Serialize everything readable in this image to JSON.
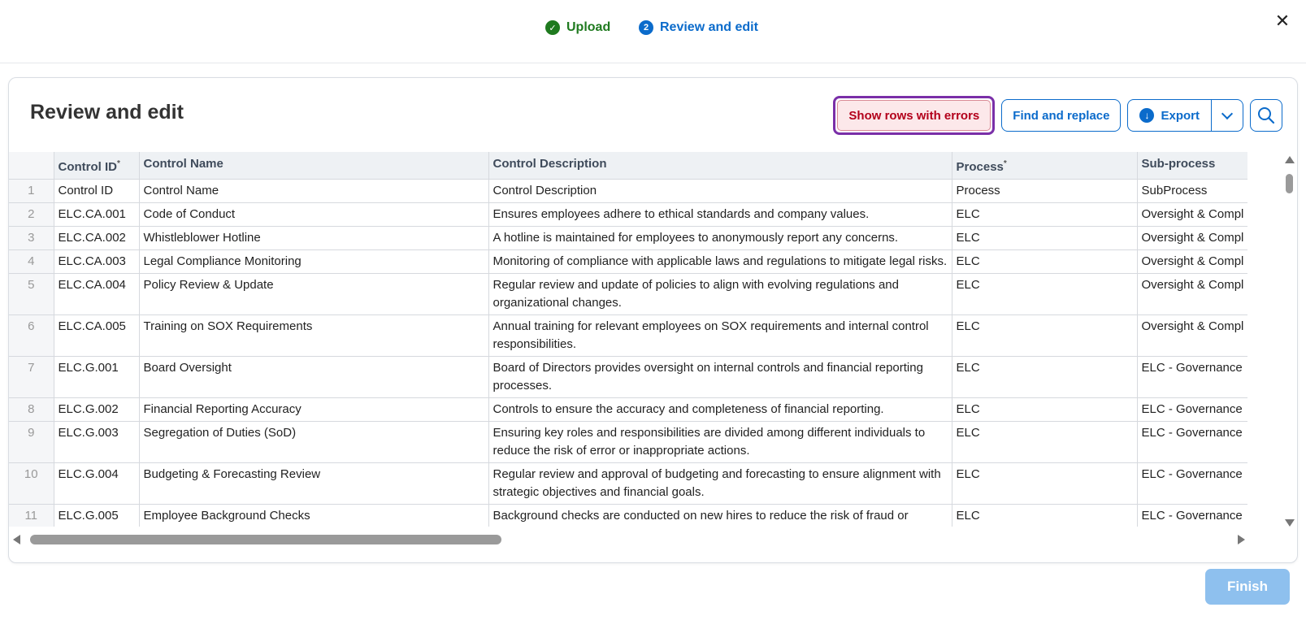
{
  "stepper": {
    "steps": [
      {
        "label": "Upload",
        "badge": "✓"
      },
      {
        "label": "Review and edit",
        "badge": "2"
      }
    ],
    "close_label": "✕"
  },
  "card": {
    "title": "Review and edit",
    "toolbar": {
      "show_errors": "Show rows with errors",
      "find_replace": "Find and replace",
      "export": "Export"
    }
  },
  "table": {
    "columns": [
      "Control ID",
      "Control Name",
      "Control Description",
      "Process",
      "Sub-process"
    ],
    "required": [
      "*",
      "",
      "",
      "*",
      ""
    ],
    "rows": [
      {
        "n": "1",
        "id": "Control ID",
        "name": "Control Name",
        "desc": "Control Description",
        "process": "Process",
        "sub": "SubProcess"
      },
      {
        "n": "2",
        "id": "ELC.CA.001",
        "name": "Code of Conduct",
        "desc": "Ensures employees adhere to ethical standards and company values.",
        "process": "ELC",
        "sub": "Oversight & Compl"
      },
      {
        "n": "3",
        "id": "ELC.CA.002",
        "name": "Whistleblower Hotline",
        "desc": "A hotline is maintained for employees to anonymously report any concerns.",
        "process": "ELC",
        "sub": "Oversight & Compl"
      },
      {
        "n": "4",
        "id": "ELC.CA.003",
        "name": "Legal Compliance Monitoring",
        "desc": "Monitoring of compliance with applicable laws and regulations to mitigate legal risks.",
        "process": "ELC",
        "sub": "Oversight & Compl"
      },
      {
        "n": "5",
        "id": "ELC.CA.004",
        "name": "Policy Review & Update",
        "desc": "Regular review and update of policies to align with evolving regulations and organizational changes.",
        "process": "ELC",
        "sub": "Oversight & Compl"
      },
      {
        "n": "6",
        "id": "ELC.CA.005",
        "name": "Training on SOX Requirements",
        "desc": "Annual training for relevant employees on SOX requirements and internal control responsibilities.",
        "process": "ELC",
        "sub": "Oversight & Compl"
      },
      {
        "n": "7",
        "id": "ELC.G.001",
        "name": "Board Oversight",
        "desc": "Board of Directors provides oversight on internal controls and financial reporting processes.",
        "process": "ELC",
        "sub": "ELC - Governance"
      },
      {
        "n": "8",
        "id": "ELC.G.002",
        "name": "Financial Reporting Accuracy",
        "desc": "Controls to ensure the accuracy and completeness of financial reporting.",
        "process": "ELC",
        "sub": "ELC - Governance"
      },
      {
        "n": "9",
        "id": "ELC.G.003",
        "name": "Segregation of Duties (SoD)",
        "desc": "Ensuring key roles and responsibilities are divided among different individuals to reduce the risk of error or inappropriate actions.",
        "process": "ELC",
        "sub": "ELC - Governance"
      },
      {
        "n": "10",
        "id": "ELC.G.004",
        "name": "Budgeting & Forecasting Review",
        "desc": "Regular review and approval of budgeting and forecasting to ensure alignment with strategic objectives and financial goals.",
        "process": "ELC",
        "sub": "ELC - Governance"
      },
      {
        "n": "11",
        "id": "ELC.G.005",
        "name": "Employee Background Checks",
        "desc": "Background checks are conducted on new hires to reduce the risk of fraud or conflicts of interest.",
        "process": "ELC",
        "sub": "ELC - Governance"
      }
    ]
  },
  "footer": {
    "finish": "Finish"
  }
}
